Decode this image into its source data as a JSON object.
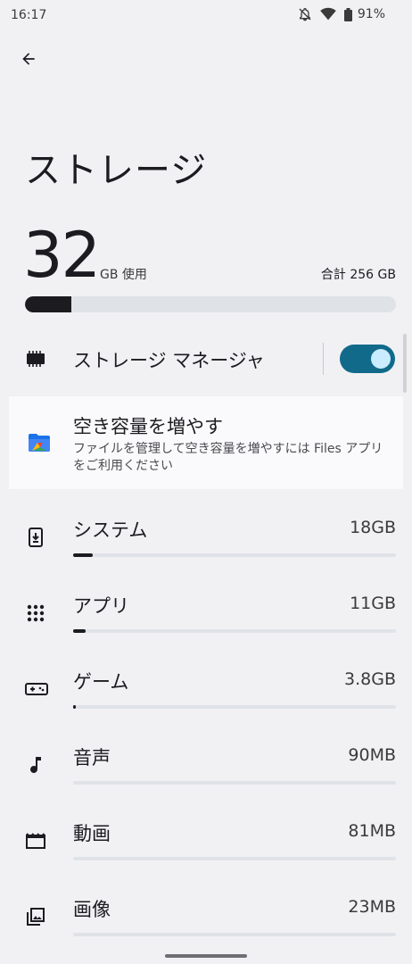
{
  "status_bar": {
    "time": "16:17",
    "battery_percent": "91%"
  },
  "header": {
    "title": "ストレージ"
  },
  "summary": {
    "used_value": "32",
    "used_unit": "GB 使用",
    "total_label": "合計 256 GB",
    "used_fraction": 0.125
  },
  "storage_manager": {
    "label": "ストレージ マネージャ",
    "enabled": true
  },
  "free_up": {
    "title": "空き容量を増やす",
    "description": "ファイルを管理して空き容量を増やすには Files アプリをご利用ください"
  },
  "categories": [
    {
      "name": "システム",
      "size": "18GB",
      "fraction": 0.06,
      "icon": "system-update-icon"
    },
    {
      "name": "アプリ",
      "size": "11GB",
      "fraction": 0.04,
      "icon": "apps-grid-icon"
    },
    {
      "name": "ゲーム",
      "size": "3.8GB",
      "fraction": 0.008,
      "icon": "gamepad-icon"
    },
    {
      "name": "音声",
      "size": "90MB",
      "fraction": 0.0,
      "icon": "music-note-icon"
    },
    {
      "name": "動画",
      "size": "81MB",
      "fraction": 0.0,
      "icon": "movie-icon"
    },
    {
      "name": "画像",
      "size": "23MB",
      "fraction": 0.0,
      "icon": "image-icon"
    }
  ],
  "colors": {
    "accent": "#126a8a",
    "bar_fill": "#1c1b1f",
    "track": "#dfe3e8"
  }
}
